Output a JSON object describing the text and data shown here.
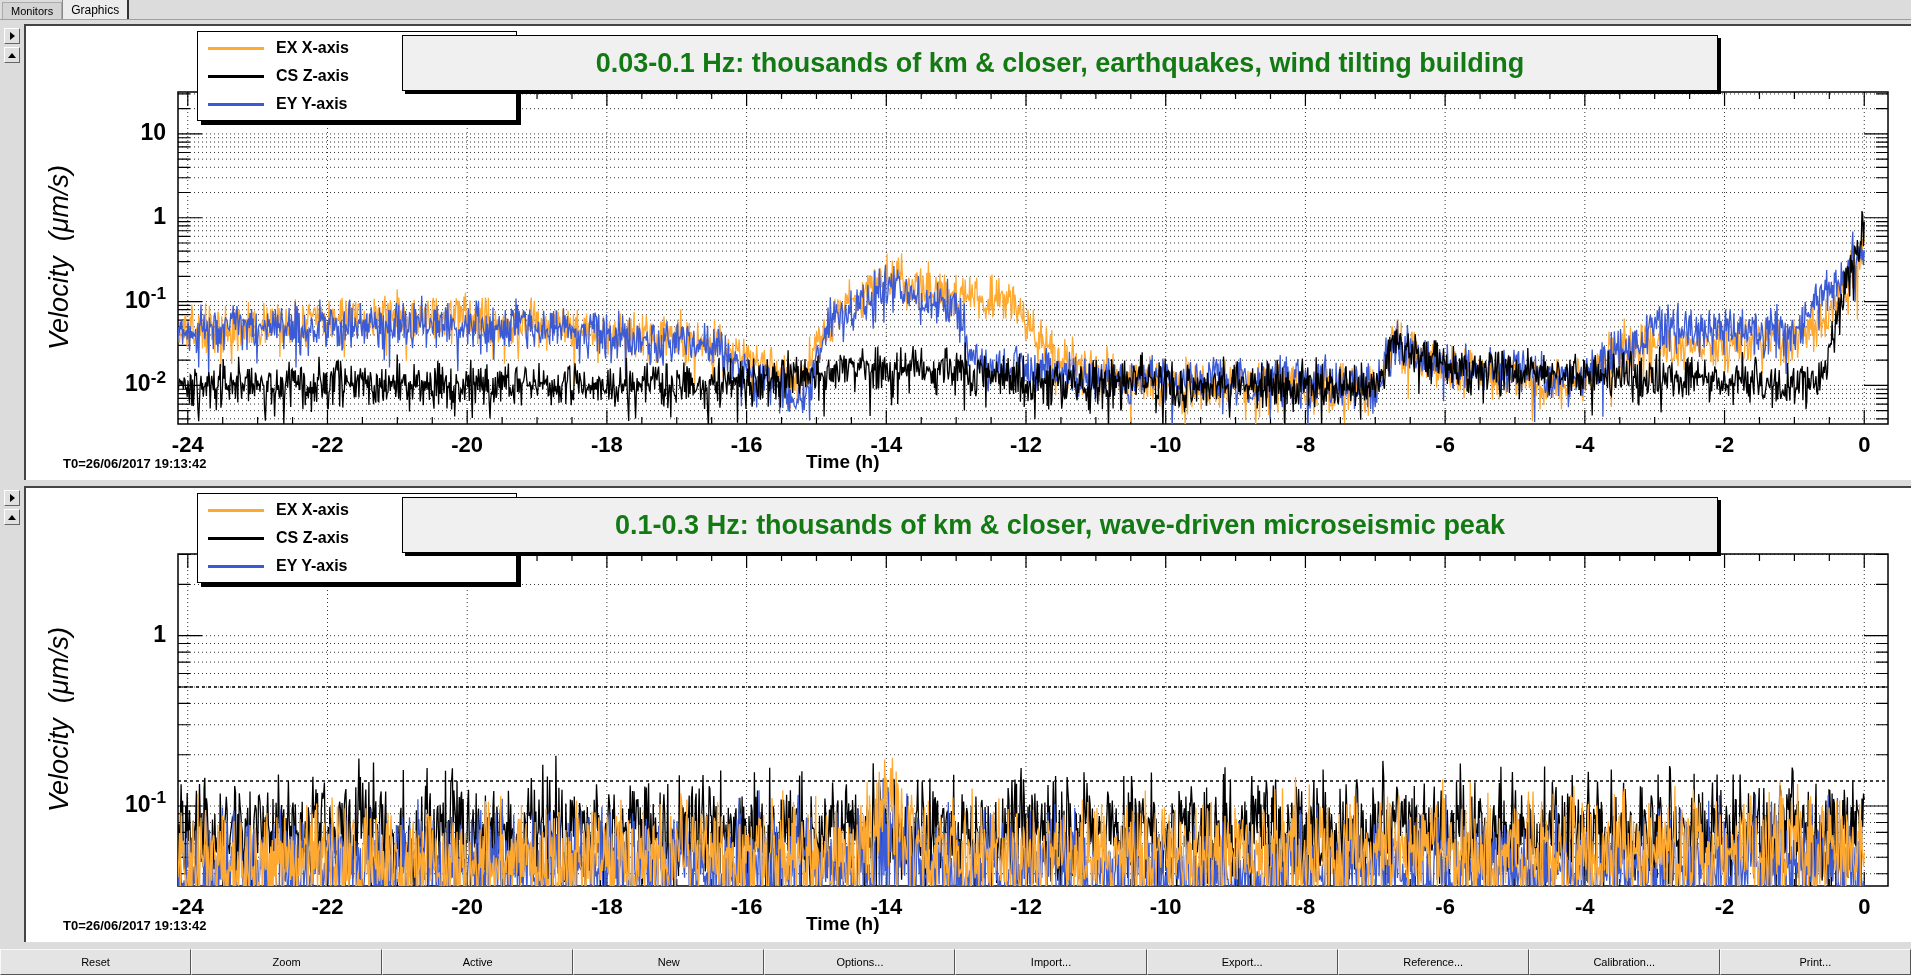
{
  "tabs": [
    {
      "label": "Monitors",
      "selected": false
    },
    {
      "label": "Graphics",
      "selected": true
    }
  ],
  "panels": [
    {
      "title": "0.03-0.1 Hz: thousands of km & closer, earthquakes, wind tilting building",
      "legend": [
        {
          "label": "EX X-axis",
          "color": "#ffa930"
        },
        {
          "label": "CS Z-axis",
          "color": "#000000"
        },
        {
          "label": "EY Y-axis",
          "color": "#3b5bd6"
        }
      ],
      "y_axis_label": "Velocity  (μm/s)",
      "y_tick_labels": [
        "10",
        "1",
        "10$^{-1}$",
        "10$^{-2}$"
      ],
      "x_tick_labels": [
        "-24",
        "-22",
        "-20",
        "-18",
        "-16",
        "-14",
        "-12",
        "-10",
        "-8",
        "-6",
        "-4",
        "-2",
        "0"
      ],
      "x_axis_label": "Time (h)",
      "t0_label": "T0=26/06/2017 19:13:42"
    },
    {
      "title": "0.1-0.3 Hz: thousands of km & closer, wave-driven microseismic peak",
      "legend": [
        {
          "label": "EX X-axis",
          "color": "#ffa930"
        },
        {
          "label": "CS Z-axis",
          "color": "#000000"
        },
        {
          "label": "EY Y-axis",
          "color": "#3b5bd6"
        }
      ],
      "y_axis_label": "Velocity  (μm/s)",
      "y_tick_labels": [
        "1",
        "10$^{-1}$"
      ],
      "x_tick_labels": [
        "-24",
        "-22",
        "-20",
        "-18",
        "-16",
        "-14",
        "-12",
        "-10",
        "-8",
        "-6",
        "-4",
        "-2",
        "0"
      ],
      "x_axis_label": "Time (h)",
      "t0_label": "T0=26/06/2017 19:13:42"
    }
  ],
  "toolbar": [
    "Reset",
    "Zoom",
    "Active",
    "New",
    "Options...",
    "Import...",
    "Export...",
    "Reference...",
    "Calibration...",
    "Print..."
  ]
}
